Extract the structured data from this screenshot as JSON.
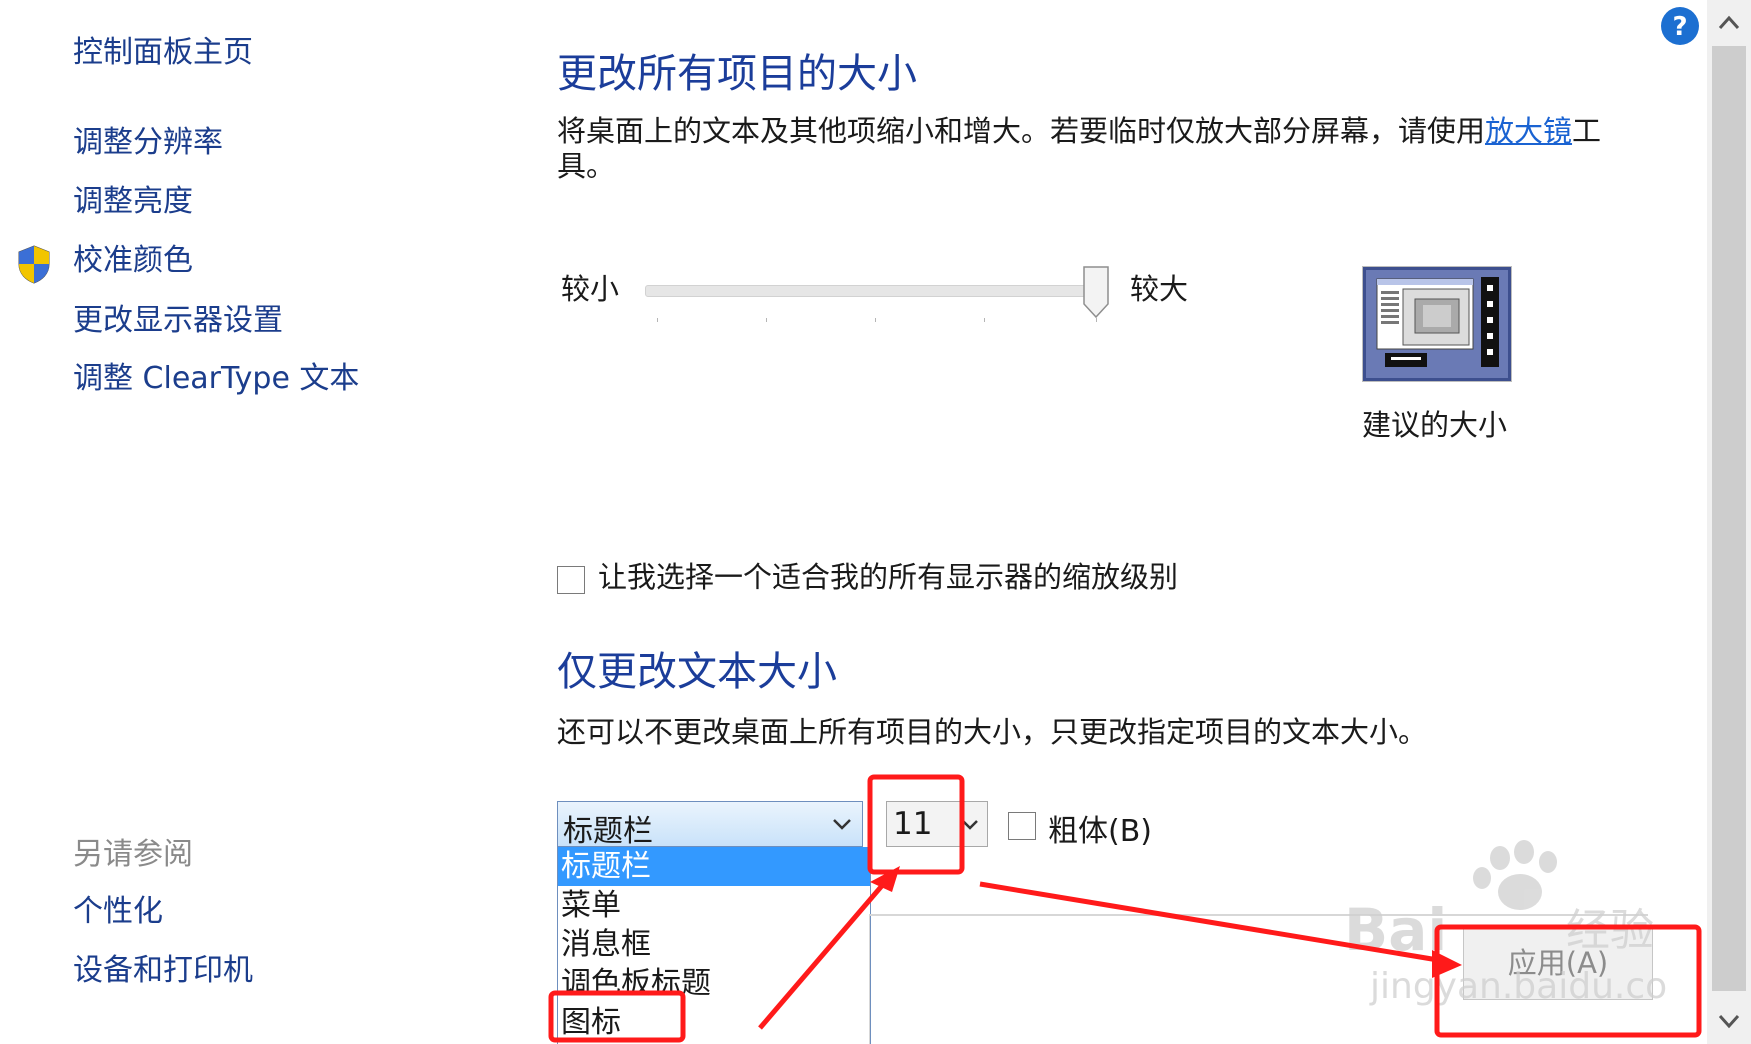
{
  "sidebar": {
    "home": "控制面板主页",
    "items": [
      {
        "label": "调整分辨率"
      },
      {
        "label": "调整亮度"
      },
      {
        "label": "校准颜色",
        "icon": "uac-shield-icon"
      },
      {
        "label": "更改显示器设置"
      },
      {
        "label": "调整 ClearType 文本"
      }
    ],
    "see_also_heading": "另请参阅",
    "see_also": [
      {
        "label": "个性化"
      },
      {
        "label": "设备和打印机"
      }
    ]
  },
  "section_all": {
    "title": "更改所有项目的大小",
    "desc_before_link": "将桌面上的文本及其他项缩小和增大。若要临时仅放大部分屏幕，请使用",
    "link": "放大镜",
    "desc_after_link": "工具。",
    "slider": {
      "min_label": "较小",
      "max_label": "较大",
      "value_percent": 100
    },
    "preview_caption": "建议的大小",
    "custom_scaling_checkbox": "让我选择一个适合我的所有显示器的缩放级别"
  },
  "section_text": {
    "title": "仅更改文本大小",
    "desc": "还可以不更改桌面上所有项目的大小，只更改指定项目的文本大小。",
    "item_select": {
      "value": "标题栏",
      "options": [
        "标题栏",
        "菜单",
        "消息框",
        "调色板标题",
        "图标"
      ],
      "selected_index": 0
    },
    "size_select": {
      "value": "11"
    },
    "bold_label": "粗体(B)",
    "apply_label": "应用(A)"
  },
  "watermark": {
    "text": "Bai",
    "text2": "经验",
    "sub": "jingyan.baidu.com"
  },
  "colors": {
    "link": "#1b3d8c",
    "heading": "#1b3d9a",
    "selection": "#3399ff",
    "annotation": "#ff1a1a"
  }
}
